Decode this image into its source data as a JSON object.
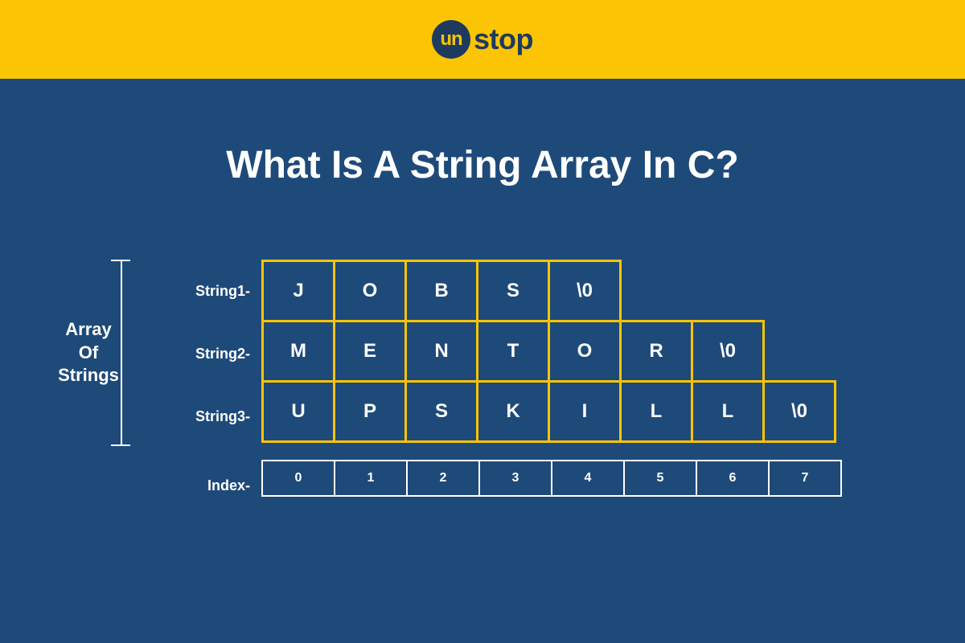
{
  "logo": {
    "circle_text": "un",
    "text": "stop"
  },
  "title": "What Is A String Array In C?",
  "bracket_label": "Array\nOf\nStrings",
  "rows": [
    {
      "label": "String1-",
      "cells": [
        "J",
        "O",
        "B",
        "S",
        "\\0"
      ]
    },
    {
      "label": "String2-",
      "cells": [
        "M",
        "E",
        "N",
        "T",
        "O",
        "R",
        "\\0"
      ]
    },
    {
      "label": "String3-",
      "cells": [
        "U",
        "P",
        "S",
        "K",
        "I",
        "L",
        "L",
        "\\0"
      ]
    }
  ],
  "index_label": "Index-",
  "indices": [
    "0",
    "1",
    "2",
    "3",
    "4",
    "5",
    "6",
    "7"
  ]
}
